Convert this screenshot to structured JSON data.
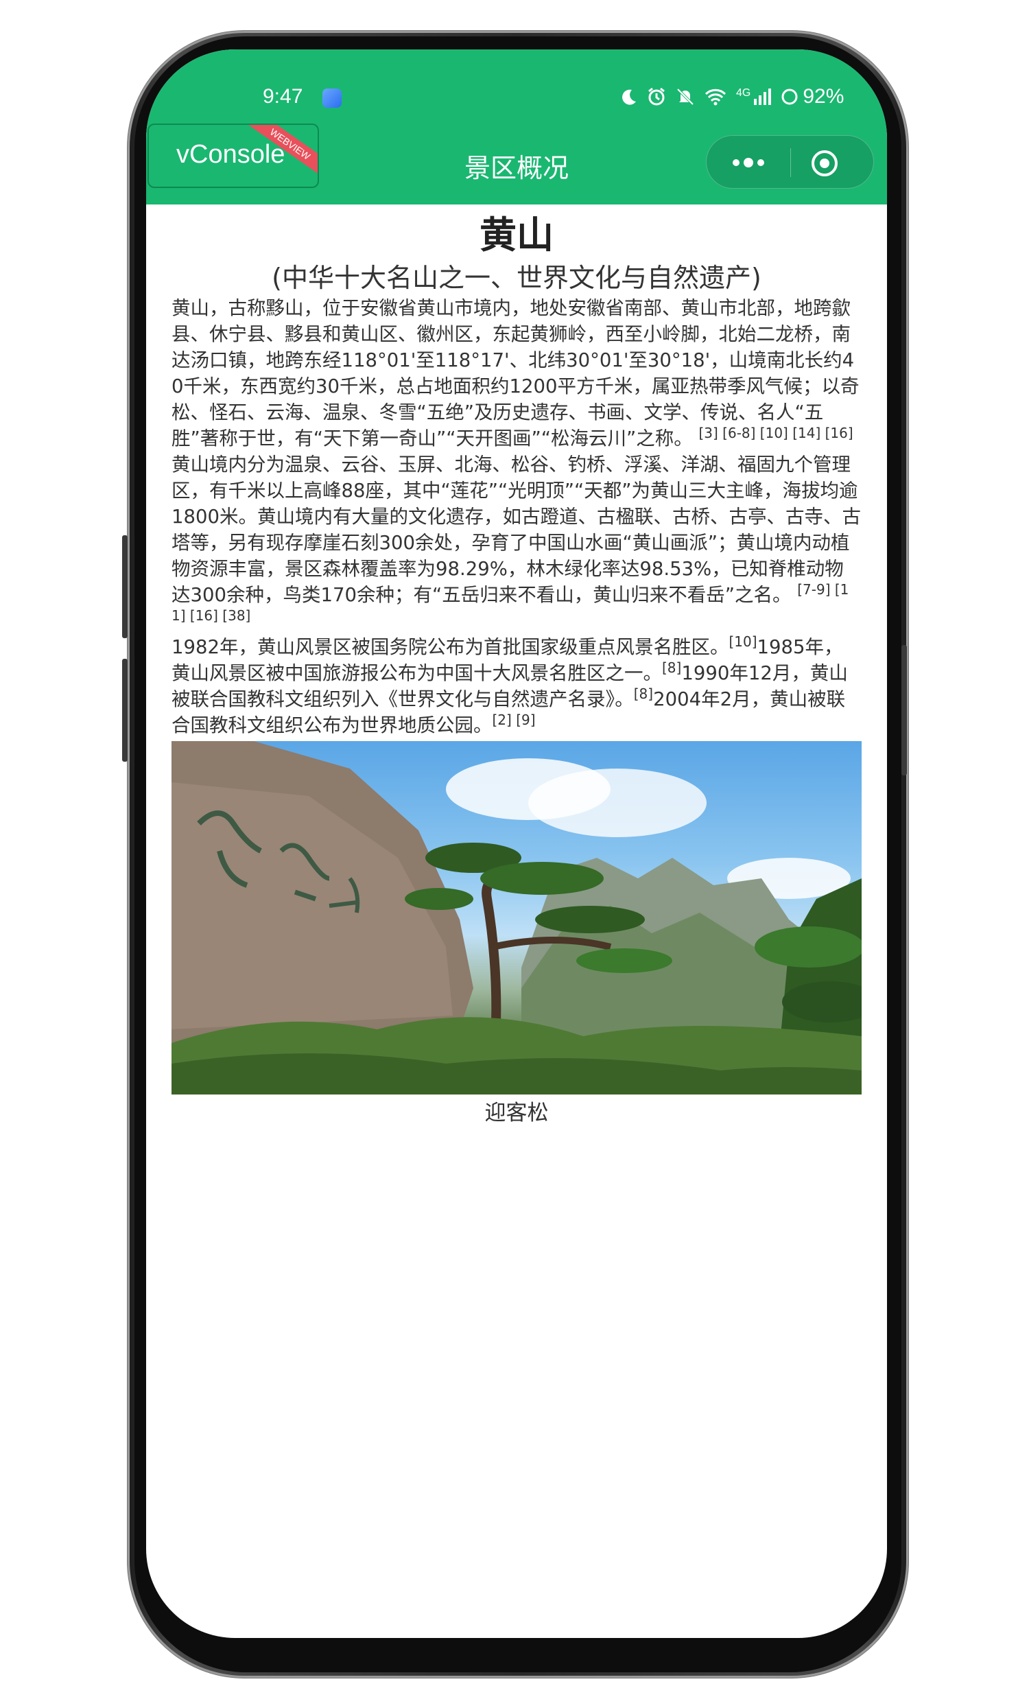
{
  "status_bar": {
    "time": "9:47",
    "battery": "92%",
    "network": "4G"
  },
  "vconsole": {
    "label": "vConsole",
    "ribbon": "WEBVIEW"
  },
  "nav": {
    "title": "景区概况"
  },
  "article": {
    "title": "黄山",
    "subtitle": "(中华十大名山之一、世界文化与自然遗产)",
    "p1": "黄山，古称黟山，位于安徽省黄山市境内，地处安徽省南部、黄山市北部，地跨歙县、休宁县、黟县和黄山区、徽州区，东起黄狮岭，西至小岭脚，北始二龙桥，南达汤口镇，地跨东经118°01'至118°17'、北纬30°01'至30°18'，山境南北长约40千米，东西宽约30千米，总占地面积约1200平方千米，属亚热带季风气候；以奇松、怪石、云海、温泉、冬雪“五绝”及历史遗存、书画、文学、传说、名人“五胜”著称于世，有“天下第一奇山”“天开图画”“松海云川”之称。",
    "p1_refs": "[3] [6-8] [10] [14] [16]",
    "p2": "黄山境内分为温泉、云谷、玉屏、北海、松谷、钓桥、浮溪、洋湖、福固九个管理区，有千米以上高峰88座，其中“莲花”“光明顶”“天都”为黄山三大主峰，海拔均逾1800米。黄山境内有大量的文化遗存，如古蹬道、古楹联、古桥、古亭、古寺、古塔等，另有现存摩崖石刻300余处，孕育了中国山水画“黄山画派”；黄山境内动植物资源丰富，景区森林覆盖率为98.29%，林木绿化率达98.53%，已知脊椎动物达300余种，鸟类170余种；有“五岳归来不看山，黄山归来不看岳”之名。",
    "p2_refs": "[7-9] [11] [16] [38]",
    "p3_a": "1982年，黄山风景区被国务院公布为首批国家级重点风景名胜区。",
    "p3_ref_a": "[10]",
    "p3_b": "1985年，黄山风景区被中国旅游报公布为中国十大风景名胜区之一。",
    "p3_ref_b": "[8]",
    "p3_c": "1990年12月，黄山被联合国教科文组织列入《世界文化与自然遗产名录》。",
    "p3_ref_c": "[8]",
    "p3_d": "2004年2月，黄山被联合国教科文组织公布为世界地质公园。",
    "p3_ref_d": "[2] [9]",
    "image_caption": "迎客松"
  },
  "colors": {
    "header_green": "#1ab771",
    "ribbon_red": "#e8505b"
  }
}
